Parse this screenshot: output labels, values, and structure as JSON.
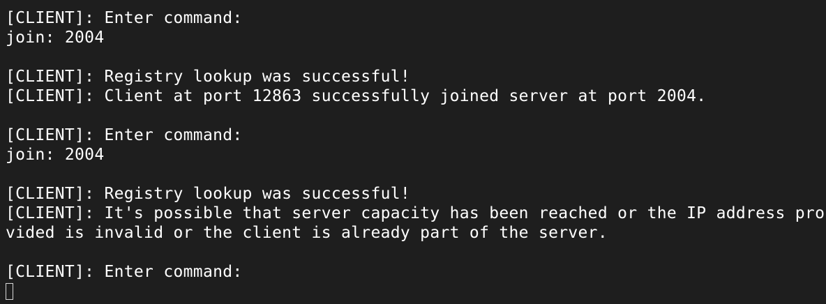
{
  "terminal": {
    "lines": [
      "[CLIENT]: Enter command:",
      "join: 2004",
      "",
      "[CLIENT]: Registry lookup was successful!",
      "[CLIENT]: Client at port 12863 successfully joined server at port 2004.",
      "",
      "[CLIENT]: Enter command:",
      "join: 2004",
      "",
      "[CLIENT]: Registry lookup was successful!",
      "[CLIENT]: It's possible that server capacity has been reached or the IP address pro",
      "vided is invalid or the client is already part of the server.",
      "",
      "[CLIENT]: Enter command:"
    ],
    "colors": {
      "background": "#1e1e1e",
      "text": "#ffffff",
      "cursor": "#d8d8d8"
    }
  }
}
